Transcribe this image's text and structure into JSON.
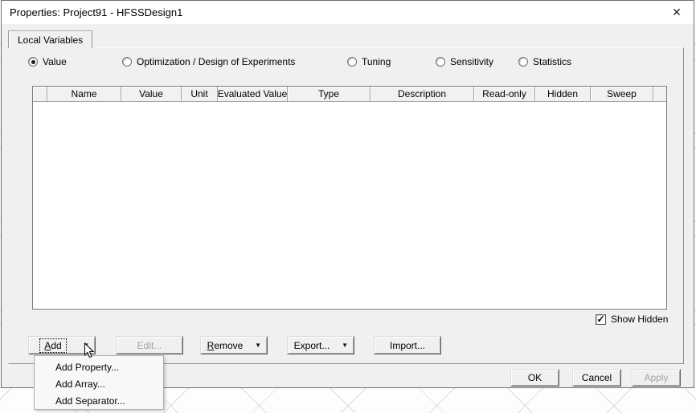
{
  "window": {
    "title": "Properties: Project91 - HFSSDesign1"
  },
  "icons": {
    "close": "✕",
    "dropdown": "▼",
    "check": "✓"
  },
  "colors": {
    "dialog_bg": "#f0f0f0",
    "titlebar_bg": "#ffffff",
    "hatch_line": "#bebedc",
    "disabled_text": "#a3a3a3"
  },
  "tabs": [
    {
      "label": "Local Variables",
      "active": true
    }
  ],
  "radios": [
    {
      "label": "Value",
      "selected": true
    },
    {
      "label": "Optimization / Design of Experiments",
      "selected": false
    },
    {
      "label": "Tuning",
      "selected": false
    },
    {
      "label": "Sensitivity",
      "selected": false
    },
    {
      "label": "Statistics",
      "selected": false
    }
  ],
  "table": {
    "columns": [
      "",
      "Name",
      "Value",
      "Unit",
      "Evaluated Value",
      "Type",
      "Description",
      "Read-only",
      "Hidden",
      "Sweep"
    ],
    "rows": []
  },
  "show_hidden": {
    "label": "Show Hidden",
    "checked": true
  },
  "toolbar": {
    "add_label": "Add",
    "edit_label": "Edit...",
    "edit_enabled": false,
    "remove_label": "Remove",
    "export_label": "Export...",
    "import_label": "Import..."
  },
  "add_menu": {
    "open": true,
    "items": [
      {
        "label": "Add Property..."
      },
      {
        "label": "Add Array..."
      },
      {
        "label": "Add Separator..."
      }
    ]
  },
  "footer": {
    "ok_label": "OK",
    "cancel_label": "Cancel",
    "apply_label": "Apply",
    "apply_enabled": false
  }
}
